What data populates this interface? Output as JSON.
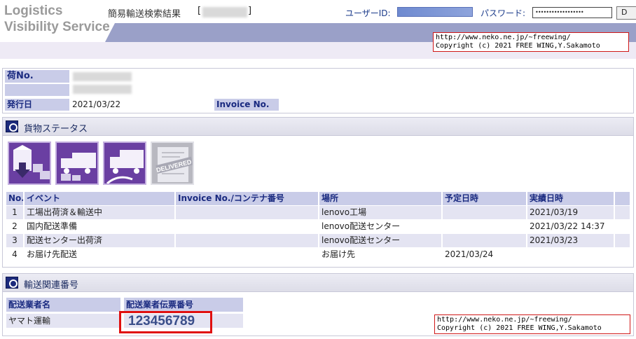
{
  "header": {
    "logo_line1": "Logistics",
    "logo_line2": "Visibility Service",
    "page_title": "簡易輸送検索結果",
    "bracket_open": "[",
    "bracket_close": "]",
    "user_id_label": "ユーザーID:",
    "password_label": "パスワード:",
    "password_value": "••••••••••••••••••",
    "login_button_label": "D"
  },
  "credit": {
    "line1": "http://www.neko.ne.jp/~freewing/",
    "line2": "Copyright (c) 2021 FREE WING,Y.Sakamoto"
  },
  "shipment_info": {
    "nimotsu_label": "荷No.",
    "issue_date_label": "発行日",
    "issue_date": "2021/03/22",
    "invoice_label": "Invoice No."
  },
  "cargo_status": {
    "title": "貨物ステータス",
    "icons": [
      "factory-shipping-icon",
      "domestic-prep-icon",
      "truck-departure-icon",
      "delivered-icon"
    ],
    "delivered_stamp": "DELIVERED",
    "columns": {
      "no": "No.",
      "event": "イベント",
      "invoice": "Invoice No./コンテナ番号",
      "location": "場所",
      "scheduled": "予定日時",
      "actual": "実績日時"
    },
    "rows": [
      {
        "no": "1",
        "event": "工場出荷済＆輸送中",
        "invoice": "",
        "location": "lenovo工場",
        "scheduled": "",
        "actual": "2021/03/19"
      },
      {
        "no": "2",
        "event": "国内配送準備",
        "invoice": "",
        "location": "lenovo配送センター",
        "scheduled": "",
        "actual": "2021/03/22 14:37"
      },
      {
        "no": "3",
        "event": "配送センター出荷済",
        "invoice": "",
        "location": "lenovo配送センター",
        "scheduled": "",
        "actual": "2021/03/23"
      },
      {
        "no": "4",
        "event": "お届け先配送",
        "invoice": "",
        "location": "お届け先",
        "scheduled": "2021/03/24",
        "actual": ""
      }
    ]
  },
  "delivery_numbers": {
    "title": "輸送関連番号",
    "carrier_header": "配送業者名",
    "slip_header": "配送業者伝票番号",
    "carrier": "ヤマト運輸",
    "slip_number": "123456789"
  },
  "colors": {
    "accent_band": "#9aa0c8",
    "label_bg": "#c9cce8",
    "icon_purple": "#6a3fa2",
    "highlight_red": "#e01010"
  }
}
